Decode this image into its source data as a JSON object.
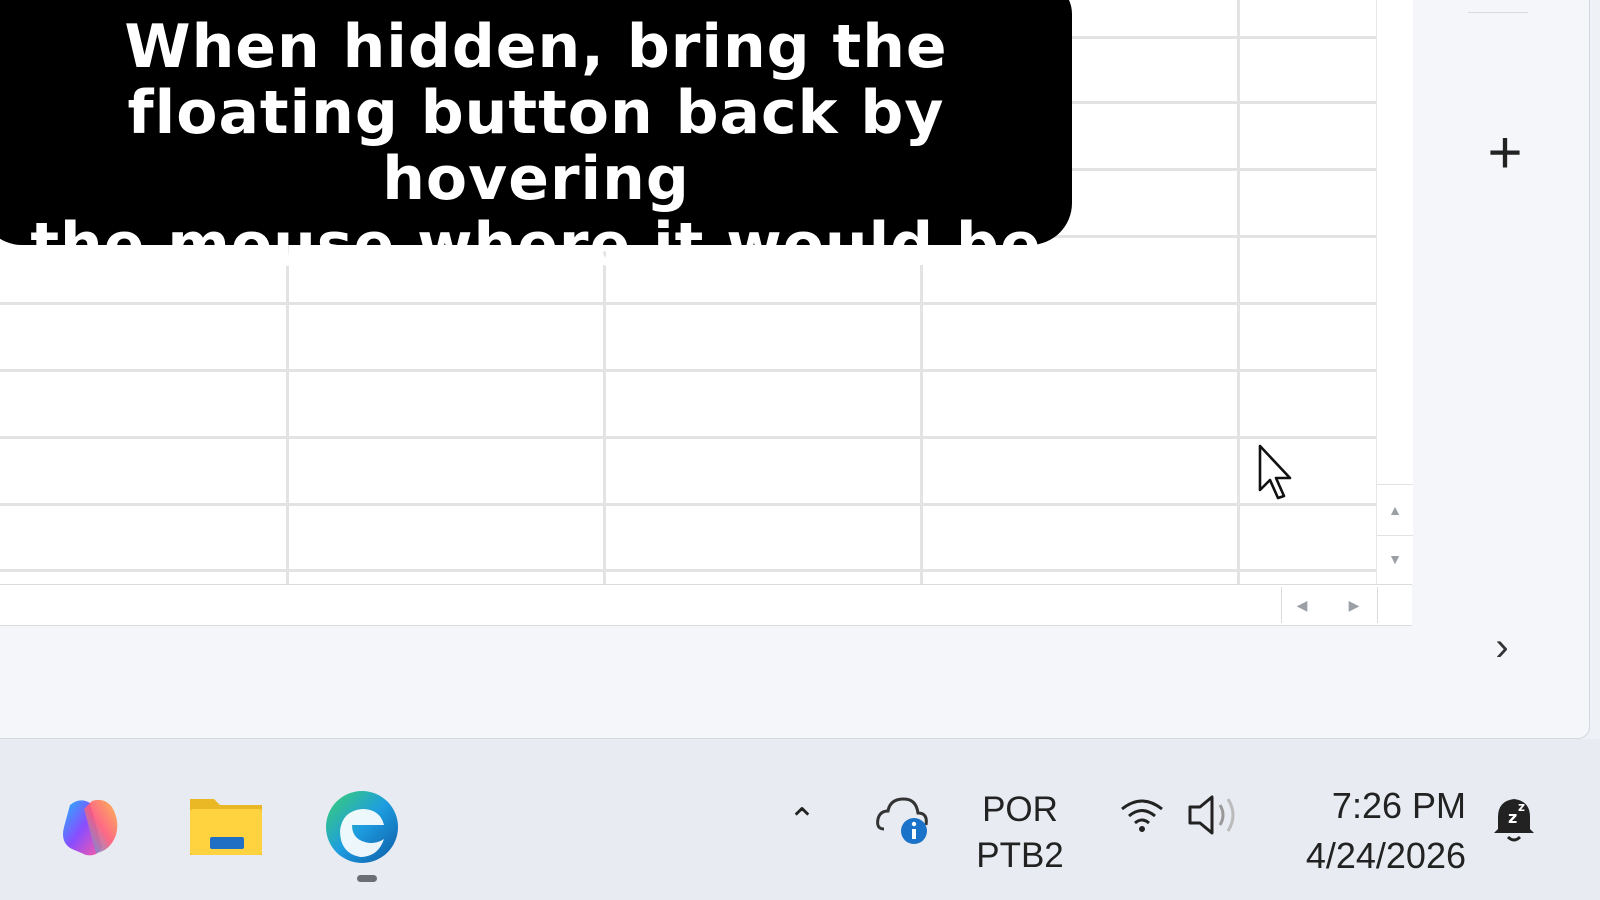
{
  "caption": {
    "lines": [
      "When hidden, bring the",
      "floating button back by hovering",
      "the mouse where it would be"
    ]
  },
  "sheet": {
    "row_count_visible": 9,
    "column_count_visible": 5
  },
  "side_panel": {
    "add_icon": "plus-icon",
    "expand_icon": "chevron-right-icon"
  },
  "taskbar": {
    "apps": [
      "copilot-icon",
      "file-explorer-icon",
      "edge-icon"
    ],
    "active_app": "edge-icon",
    "language": {
      "line1": "POR",
      "line2": "PTB2"
    },
    "clock": {
      "time": "7:26 PM",
      "date": "4/24/2026"
    },
    "tray_icons": [
      "show-hidden-icons-chevron",
      "onedrive-info-icon",
      "wifi-icon",
      "volume-icon",
      "notifications-snooze-icon"
    ]
  }
}
